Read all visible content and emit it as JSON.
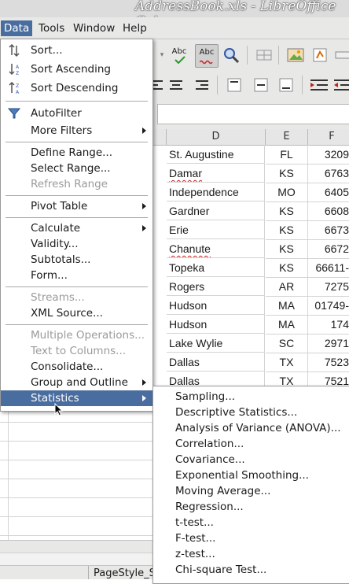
{
  "window": {
    "title": "AddressBook.xls - LibreOffice Calc"
  },
  "menubar": {
    "data": "Data",
    "tools": "Tools",
    "window": "Window",
    "help": "Help"
  },
  "toolbar": {
    "spelling": "Abc",
    "autospell": "Abc"
  },
  "columns": {
    "d": "D",
    "e": "E",
    "f": "F"
  },
  "rows": [
    {
      "city": "St. Augustine",
      "state": "FL",
      "zip": "3209"
    },
    {
      "city": "Damar",
      "state": "KS",
      "zip": "6763"
    },
    {
      "city": "Independence",
      "state": "MO",
      "zip": "6405"
    },
    {
      "city": "Gardner",
      "state": "KS",
      "zip": "6608"
    },
    {
      "city": "Erie",
      "state": "KS",
      "zip": "6673"
    },
    {
      "city": "Chanute",
      "state": "KS",
      "zip": "6672"
    },
    {
      "city": "Topeka",
      "state": "KS",
      "zip": "66611-"
    },
    {
      "city": "Rogers",
      "state": "AR",
      "zip": "7275"
    },
    {
      "city": "Hudson",
      "state": "MA",
      "zip": "01749-"
    },
    {
      "city": "Hudson",
      "state": "MA",
      "zip": "174"
    },
    {
      "city": "Lake Wylie",
      "state": "SC",
      "zip": "2971"
    },
    {
      "city": "Dallas",
      "state": "TX",
      "zip": "7523"
    },
    {
      "city": "Dallas",
      "state": "TX",
      "zip": "7521"
    }
  ],
  "data_menu": {
    "sort": "Sort...",
    "sort_asc": "Sort Ascending",
    "sort_desc": "Sort Descending",
    "autofilter": "AutoFilter",
    "more_filters": "More Filters",
    "define_range": "Define Range...",
    "select_range": "Select Range...",
    "refresh_range": "Refresh Range",
    "pivot_table": "Pivot Table",
    "calculate": "Calculate",
    "validity": "Validity...",
    "subtotals": "Subtotals...",
    "form": "Form...",
    "streams": "Streams...",
    "xml_source": "XML Source...",
    "multiple_ops": "Multiple Operations...",
    "text_to_columns": "Text to Columns...",
    "consolidate": "Consolidate...",
    "group_outline": "Group and Outline",
    "statistics": "Statistics"
  },
  "statistics_menu": {
    "sampling": "Sampling...",
    "descriptive": "Descriptive Statistics...",
    "anova": "Analysis of Variance (ANOVA)...",
    "correlation": "Correlation...",
    "covariance": "Covariance...",
    "exp_smoothing": "Exponential Smoothing...",
    "moving_avg": "Moving Average...",
    "regression": "Regression...",
    "t_test": "t-test...",
    "f_test": "F-test...",
    "z_test": "z-test...",
    "chi_square": "Chi-square Test..."
  },
  "statusbar": {
    "page_style": "PageStyle_S"
  },
  "colors": {
    "highlight": "#4a6da0",
    "menu_bg": "#ffffff",
    "chrome": "#e8e8e7"
  }
}
